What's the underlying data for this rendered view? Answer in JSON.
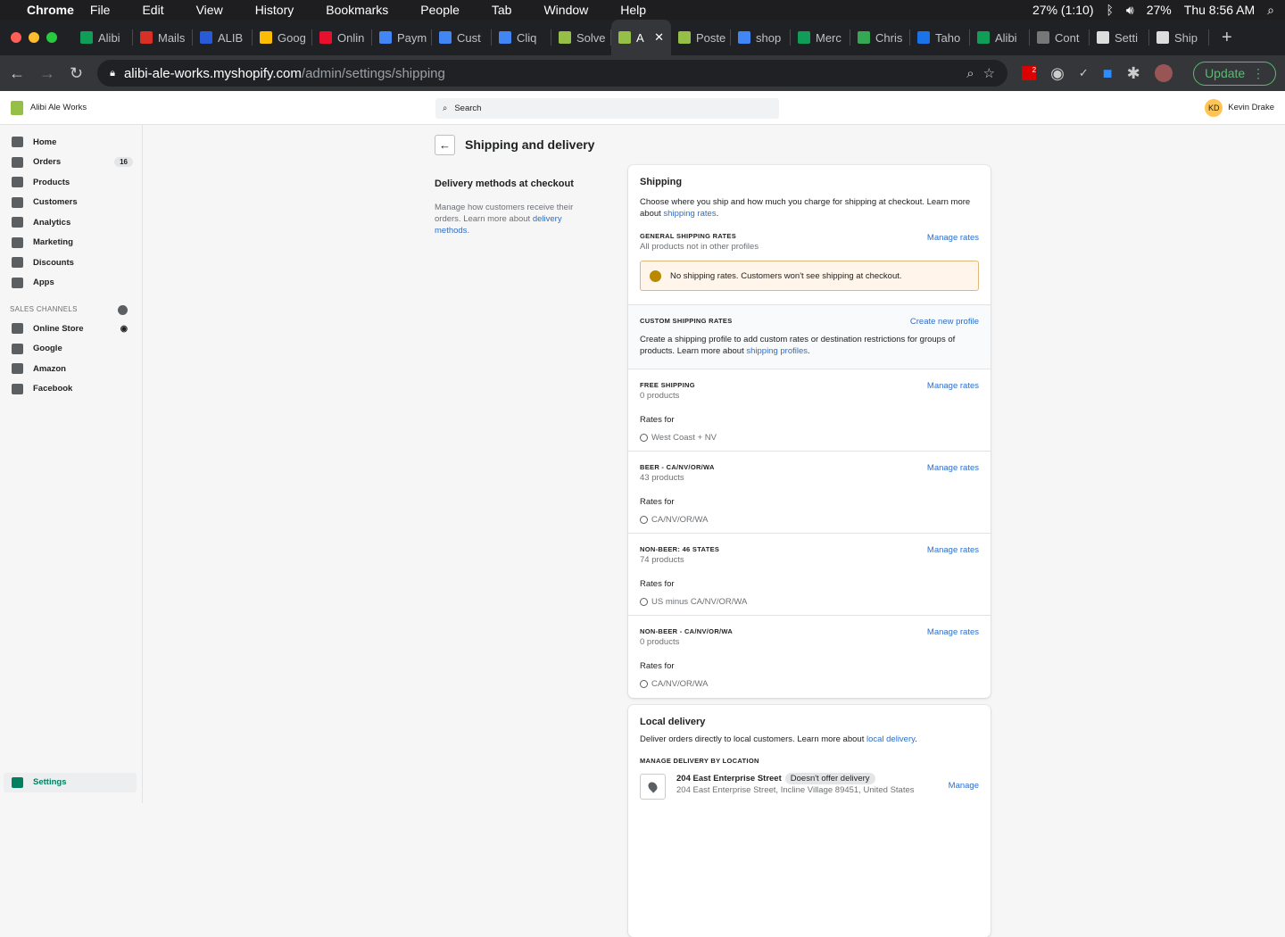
{
  "menubar": {
    "app": "Chrome",
    "items": [
      "File",
      "Edit",
      "View",
      "History",
      "Bookmarks",
      "People",
      "Tab",
      "Window",
      "Help"
    ],
    "battery1": "27% (1:10)",
    "battery2": "27%",
    "clock": "Thu 8:56 AM"
  },
  "tabs": [
    {
      "label": "Alibi",
      "color": "#0f9d58"
    },
    {
      "label": "Mails",
      "color": "#d93025"
    },
    {
      "label": "ALIB",
      "color": "#2a5bd7"
    },
    {
      "label": "Goog",
      "color": "#fbbc04"
    },
    {
      "label": "Onlin",
      "color": "#e8102d"
    },
    {
      "label": "Paym",
      "color": "#4285f4"
    },
    {
      "label": "Cust",
      "color": "#4285f4"
    },
    {
      "label": "Cliq",
      "color": "#4285f4"
    },
    {
      "label": "Solve",
      "color": "#95bf47"
    },
    {
      "label": "A",
      "color": "#95bf47",
      "active": true
    },
    {
      "label": "Poste",
      "color": "#95bf47"
    },
    {
      "label": "shop",
      "color": "#4285f4"
    },
    {
      "label": "Merc",
      "color": "#0f9d58"
    },
    {
      "label": "Chris",
      "color": "#34a853"
    },
    {
      "label": "Taho",
      "color": "#1a73e8"
    },
    {
      "label": "Alibi",
      "color": "#0f9d58"
    },
    {
      "label": "Cont",
      "color": "#777"
    },
    {
      "label": "Setti",
      "color": "#ddd"
    },
    {
      "label": "Ship",
      "color": "#ddd"
    }
  ],
  "toolbar": {
    "url_host": "alibi-ale-works.myshopify.com",
    "url_path": "/admin/settings/shipping",
    "update_label": "Update",
    "ext_badge": "2"
  },
  "topbar": {
    "store": "Alibi Ale Works",
    "search_placeholder": "Search",
    "user_initials": "KD",
    "user_name": "Kevin Drake"
  },
  "sidebar": {
    "items": [
      {
        "label": "Home"
      },
      {
        "label": "Orders",
        "badge": "16"
      },
      {
        "label": "Products"
      },
      {
        "label": "Customers"
      },
      {
        "label": "Analytics"
      },
      {
        "label": "Marketing"
      },
      {
        "label": "Discounts"
      },
      {
        "label": "Apps"
      }
    ],
    "channels_heading": "SALES CHANNELS",
    "channels": [
      "Online Store",
      "Google",
      "Amazon",
      "Facebook"
    ],
    "settings": "Settings"
  },
  "page": {
    "title": "Shipping and delivery",
    "aside_title": "Delivery methods at checkout",
    "aside_text": "Manage how customers receive their orders. Learn more about ",
    "aside_link": "delivery methods",
    "aside_end": "."
  },
  "shipping": {
    "title": "Shipping",
    "desc": "Choose where you ship and how much you charge for shipping at checkout. Learn more about ",
    "desc_link": "shipping rates",
    "general_caption": "GENERAL SHIPPING RATES",
    "general_sub": "All products not in other profiles",
    "manage": "Manage rates",
    "warning": "No shipping rates. Customers won't see shipping at checkout.",
    "custom_caption": "CUSTOM SHIPPING RATES",
    "create_profile": "Create new profile",
    "custom_desc": "Create a shipping profile to add custom rates or destination restrictions for groups of products. Learn more about ",
    "custom_link": "shipping profiles",
    "rates_for": "Rates for",
    "profiles": [
      {
        "name": "FREE SHIPPING",
        "count": "0 products",
        "dest": "West Coast + NV"
      },
      {
        "name": "BEER - CA/NV/OR/WA",
        "count": "43 products",
        "dest": "CA/NV/OR/WA"
      },
      {
        "name": "NON-BEER: 46 STATES",
        "count": "74 products",
        "dest": "US minus CA/NV/OR/WA"
      },
      {
        "name": "NON-BEER - CA/NV/OR/WA",
        "count": "0 products",
        "dest": "CA/NV/OR/WA"
      }
    ]
  },
  "local": {
    "title": "Local delivery",
    "desc": "Deliver orders directly to local customers. Learn more about ",
    "link": "local delivery",
    "caption": "MANAGE DELIVERY BY LOCATION",
    "loc_name": "204 East Enterprise Street",
    "loc_tag": "Doesn't offer delivery",
    "loc_addr": "204 East Enterprise Street, Incline Village 89451, United States",
    "manage": "Manage"
  }
}
